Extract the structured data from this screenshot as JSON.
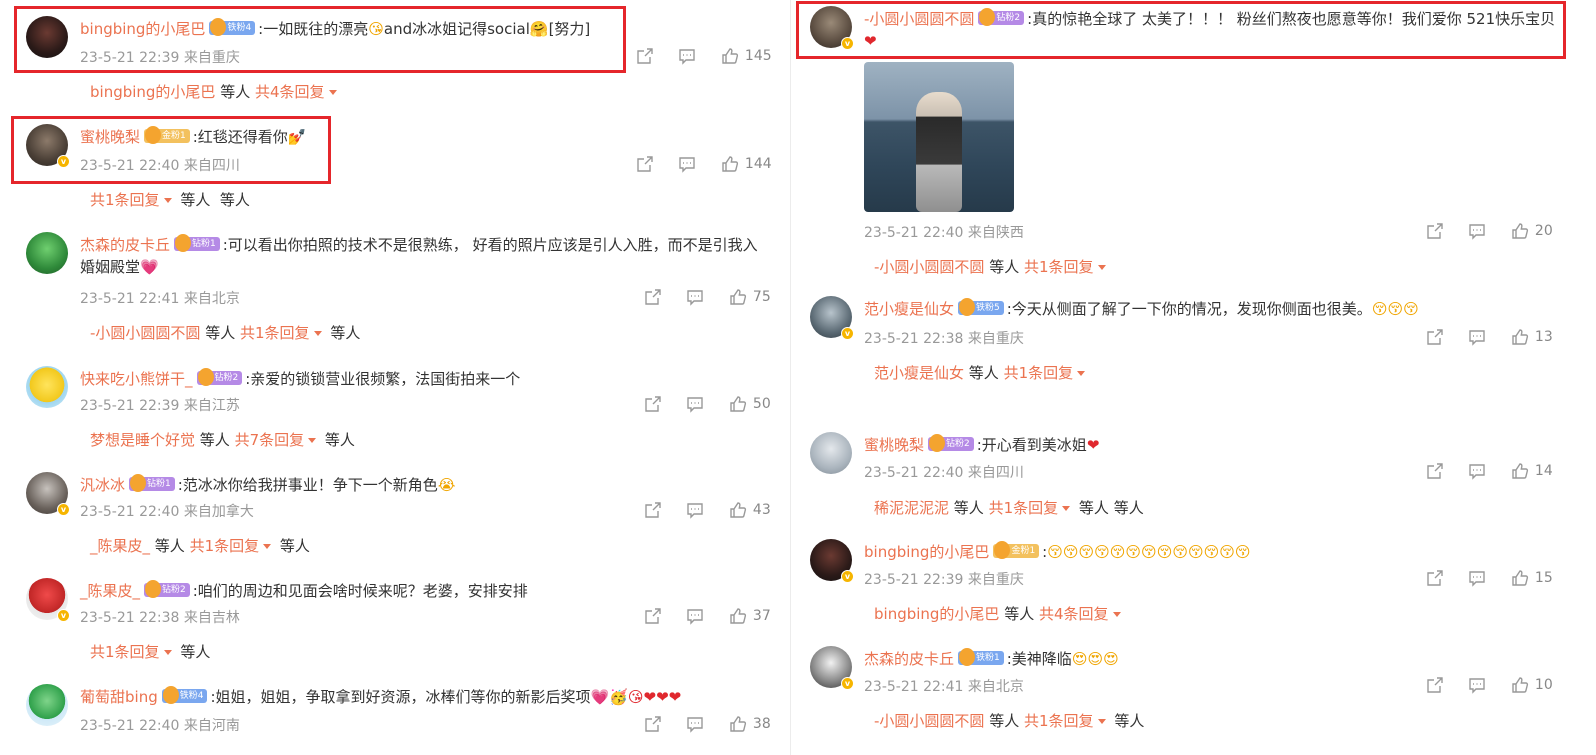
{
  "left": [
    {
      "user": "bingbing的小尾巴",
      "badge": "铁粉4",
      "badge_type": "iron",
      "text": ":一如既往的漂亮",
      "emoji_a": "😘",
      "text2": "and冰冰姐记得social",
      "emoji_b": "🤗",
      "tail": "[努力]",
      "time": "23-5-21 22:39",
      "loc": "来自重庆",
      "likes": "145",
      "replies": {
        "name": "bingbing的小尾巴",
        "etc": "等人",
        "total": "共4条回复",
        "after": ""
      }
    },
    {
      "user": "蜜桃晚梨",
      "badge": "金粉1",
      "badge_type": "gold",
      "text": ":红毯还得看你",
      "emoji_a": "💅",
      "text2": "",
      "emoji_b": "",
      "tail": "",
      "time": "23-5-21 22:40",
      "loc": "来自四川",
      "likes": "144",
      "replies": {
        "name": "",
        "etc": "等人",
        "total": "共1条回复",
        "after": "等人"
      }
    },
    {
      "user": "杰森的皮卡丘",
      "badge": "钻粉1",
      "badge_type": "diamond",
      "text": ":可以看出你拍照的技术不是很熟练，  好看的照片应该是引人入胜，而不是引我入婚姻殿堂",
      "emoji_a": "💗",
      "text2": "",
      "emoji_b": "",
      "tail": "",
      "time": "23-5-21 22:41",
      "loc": "来自北京",
      "likes": "75",
      "replies": {
        "name": "-小圆小圆圆不圆",
        "etc": "等人",
        "total": "共1条回复",
        "after": "等人"
      }
    },
    {
      "user": "快来吃小熊饼干_",
      "badge": "钻粉2",
      "badge_type": "diamond",
      "text": ":亲爱的锁锁营业很频繁，法国街拍来一个",
      "emoji_a": "",
      "text2": "",
      "emoji_b": "",
      "tail": "",
      "time": "23-5-21 22:39",
      "loc": "来自江苏",
      "likes": "50",
      "replies": {
        "name": "梦想是睡个好觉",
        "etc": "等人",
        "total": "共7条回复",
        "after": "等人"
      }
    },
    {
      "user": "汎冰冰",
      "badge": "钻粉1",
      "badge_type": "diamond",
      "text": ":范冰冰你给我拼事业！争下一个新角色",
      "emoji_a": "😭",
      "text2": "",
      "emoji_b": "",
      "tail": "",
      "time": "23-5-21 22:40",
      "loc": "来自加拿大",
      "likes": "43",
      "replies": {
        "name": "_陈果皮_",
        "etc": "等人",
        "total": "共1条回复",
        "after": "等人"
      }
    },
    {
      "user": "_陈果皮_",
      "badge": "钻粉2",
      "badge_type": "diamond",
      "text": ":咱们的周边和见面会啥时候来呢？老婆，安排安排",
      "emoji_a": "",
      "text2": "",
      "emoji_b": "",
      "tail": "",
      "time": "23-5-21 22:38",
      "loc": "来自吉林",
      "likes": "37",
      "replies": {
        "name": "",
        "etc": "等人",
        "total": "共1条回复",
        "after": ""
      }
    },
    {
      "user": "葡萄甜bing",
      "badge": "铁粉4",
      "badge_type": "iron",
      "text": ":姐姐，姐姐，争取拿到好资源，冰棒们等你的新影后奖项",
      "emoji_a": "💗🥳😘❤❤❤",
      "text2": "",
      "emoji_b": "",
      "tail": "",
      "time": "23-5-21 22:40",
      "loc": "来自河南",
      "likes": "38",
      "replies": null
    }
  ],
  "right": [
    {
      "user": "-小圆小圆圆不圆",
      "badge": "钻粉2",
      "badge_type": "diamond",
      "text": ":真的惊艳全球了 太美了！！！ 粉丝们熬夜也愿意等你！我们爱你 521快乐宝贝",
      "emoji_a": "❤",
      "text2": "",
      "emoji_b": "",
      "tail": "",
      "time": "23-5-21 22:40",
      "loc": "来自陕西",
      "likes": "20",
      "replies": {
        "name": "-小圆小圆圆不圆",
        "etc": "等人",
        "total": "共1条回复",
        "after": ""
      }
    },
    {
      "user": "范小瘦是仙女",
      "badge": "铁粉5",
      "badge_type": "iron",
      "text": ":今天从侧面了解了一下你的情况，发现你侧面也很美。",
      "emoji_a": "😚😚😚",
      "text2": "",
      "emoji_b": "",
      "tail": "",
      "time": "23-5-21 22:38",
      "loc": "来自重庆",
      "likes": "13",
      "replies": {
        "name": "范小瘦是仙女",
        "etc": "等人",
        "total": "共1条回复",
        "after": ""
      }
    },
    {
      "user": "蜜桃晚梨",
      "badge": "钻粉2",
      "badge_type": "diamond",
      "text": ":开心看到美冰姐",
      "emoji_a": "❤",
      "text2": "",
      "emoji_b": "",
      "tail": "",
      "time": "23-5-21 22:40",
      "loc": "来自四川",
      "likes": "14",
      "replies": {
        "name": "稀泥泥泥泥",
        "etc": "等人",
        "total": "共1条回复",
        "after": "等人  等人"
      }
    },
    {
      "user": "bingbing的小尾巴",
      "badge": "金粉1",
      "badge_type": "gold",
      "text": ":",
      "emoji_a": "😚😚😚😚😚😚😚😚😚😚😚😚😚",
      "text2": "",
      "emoji_b": "",
      "tail": "",
      "time": "23-5-21 22:39",
      "loc": "来自重庆",
      "likes": "15",
      "replies": {
        "name": "bingbing的小尾巴",
        "etc": "等人",
        "total": "共4条回复",
        "after": ""
      }
    },
    {
      "user": "杰森的皮卡丘",
      "badge": "铁粉1",
      "badge_type": "iron",
      "text": ":美神降临",
      "emoji_a": "😍😍😍",
      "text2": "",
      "emoji_b": "",
      "tail": "",
      "time": "23-5-21 22:41",
      "loc": "来自北京",
      "likes": "10",
      "replies": {
        "name": "-小圆小圆圆不圆",
        "etc": "等人",
        "total": "共1条回复",
        "after": "等人"
      }
    }
  ]
}
